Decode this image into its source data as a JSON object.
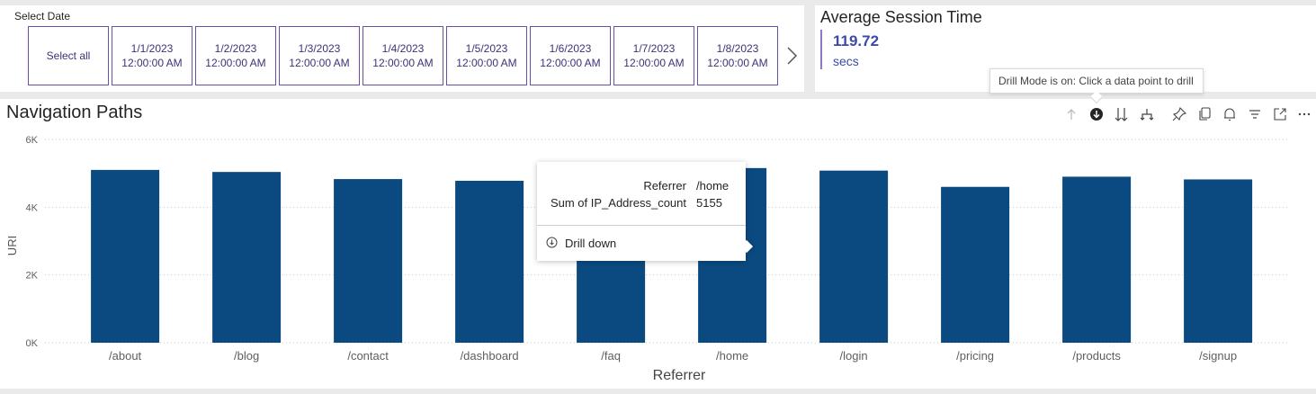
{
  "slicer": {
    "title": "Select Date",
    "select_all": "Select all",
    "items": [
      {
        "date": "1/1/2023",
        "time": "12:00:00 AM"
      },
      {
        "date": "1/2/2023",
        "time": "12:00:00 AM"
      },
      {
        "date": "1/3/2023",
        "time": "12:00:00 AM"
      },
      {
        "date": "1/4/2023",
        "time": "12:00:00 AM"
      },
      {
        "date": "1/5/2023",
        "time": "12:00:00 AM"
      },
      {
        "date": "1/6/2023",
        "time": "12:00:00 AM"
      },
      {
        "date": "1/7/2023",
        "time": "12:00:00 AM"
      },
      {
        "date": "1/8/2023",
        "time": "12:00:00 AM"
      }
    ],
    "next_icon": "chevron-right-icon"
  },
  "kpi": {
    "title": "Average Session Time",
    "value": "119.72",
    "unit": "secs"
  },
  "drill_mode_tooltip": "Drill Mode is on: Click a data point to drill",
  "toolbar": {
    "icons": [
      "drill-up-icon",
      "drill-mode-icon",
      "next-level-icon",
      "expand-hierarchy-icon",
      "pin-icon",
      "copy-icon",
      "alert-icon",
      "filter-icon",
      "focus-mode-icon",
      "more-options-icon"
    ]
  },
  "colors": {
    "bar": "#0b4a81",
    "accent": "#3b4aa8",
    "slicer_border": "#6b4fa3"
  },
  "chart": {
    "title": "Navigation Paths"
  },
  "chart_data": {
    "type": "bar",
    "title": "Navigation Paths",
    "xlabel": "Referrer",
    "ylabel": "URI",
    "categories": [
      "/about",
      "/blog",
      "/contact",
      "/dashboard",
      "/faq",
      "/home",
      "/login",
      "/pricing",
      "/products",
      "/signup"
    ],
    "values": [
      5100,
      5040,
      4830,
      4780,
      4700,
      5155,
      5080,
      4600,
      4900,
      4820
    ],
    "ylim": [
      0,
      6000
    ],
    "yticks": [
      "0K",
      "2K",
      "4K",
      "6K"
    ],
    "grid": true
  },
  "data_tooltip": {
    "rows": [
      {
        "label": "Referrer",
        "value": "/home"
      },
      {
        "label": "Sum of IP_Address_count",
        "value": "5155"
      }
    ],
    "action": "Drill down",
    "action_icon": "drill-down-icon"
  }
}
